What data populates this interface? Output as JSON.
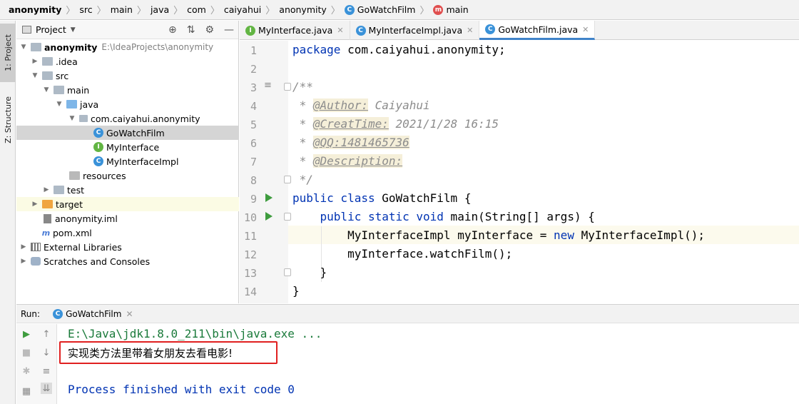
{
  "breadcrumb": [
    {
      "label": "anonymity",
      "icon": ""
    },
    {
      "label": "src",
      "icon": ""
    },
    {
      "label": "main",
      "icon": ""
    },
    {
      "label": "java",
      "icon": ""
    },
    {
      "label": "com",
      "icon": ""
    },
    {
      "label": "caiyahui",
      "icon": ""
    },
    {
      "label": "anonymity",
      "icon": ""
    },
    {
      "label": "GoWatchFilm",
      "icon": "class-icon"
    },
    {
      "label": "main",
      "icon": "method-icon"
    }
  ],
  "left_strip": {
    "project_tab": "1: Project",
    "structure_tab": "Z: Structure"
  },
  "project_panel": {
    "title": "Project",
    "tree": {
      "root_name": "anonymity",
      "root_path": "E:\\IdeaProjects\\anonymity",
      "idea": ".idea",
      "src": "src",
      "main": "main",
      "java": "java",
      "package": "com.caiyahui.anonymity",
      "file1": "GoWatchFilm",
      "file2": "MyInterface",
      "file3": "MyInterfaceImpl",
      "resources": "resources",
      "test": "test",
      "target": "target",
      "iml": "anonymity.iml",
      "pom": "pom.xml",
      "ext_libs": "External Libraries",
      "scratches": "Scratches and Consoles"
    }
  },
  "editor_tabs": [
    {
      "label": "MyInterface.java",
      "icon": "interface-icon",
      "active": false
    },
    {
      "label": "MyInterfaceImpl.java",
      "icon": "class-icon",
      "active": false
    },
    {
      "label": "GoWatchFilm.java",
      "icon": "class-icon",
      "active": true
    }
  ],
  "editor": {
    "line_numbers": [
      "1",
      "2",
      "3",
      "4",
      "5",
      "6",
      "7",
      "8",
      "9",
      "10",
      "11",
      "12",
      "13",
      "14"
    ],
    "code": {
      "l1_kw": "package",
      "l1_rest": " com.caiyahui.anonymity;",
      "l3": "/**",
      "l4_tag": "@Author:",
      "l4_val": "Caiyahui",
      "l5_tag": "@CreatTime:",
      "l5_val": "2021/1/28 16:15",
      "l6_tag": "@QQ:1481465736",
      "l7_tag": "@Description:",
      "l8": " */",
      "l9_kw": "public class",
      "l9_rest": " GoWatchFilm {",
      "l10_kw": "public static void",
      "l10_rest": " main(String[] args) {",
      "l11_a": "MyInterfaceImpl myInterface = ",
      "l11_kw": "new",
      "l11_b": " MyInterfaceImpl();",
      "l12": "myInterface.watchFilm();",
      "l13": "}",
      "l14": "}"
    }
  },
  "run_panel": {
    "label": "Run:",
    "tab": "GoWatchFilm",
    "console": {
      "command": "E:\\Java\\jdk1.8.0_211\\bin\\java.exe ...",
      "output": "实现类方法里带着女朋友去看电影!",
      "exit": "Process finished with exit code 0"
    }
  },
  "colors": {
    "keyword": "#0033b3",
    "comment": "#8c8c8c",
    "console_green": "#1a7a3a",
    "console_blue": "#0033b3",
    "highlight_box": "#e02020"
  }
}
